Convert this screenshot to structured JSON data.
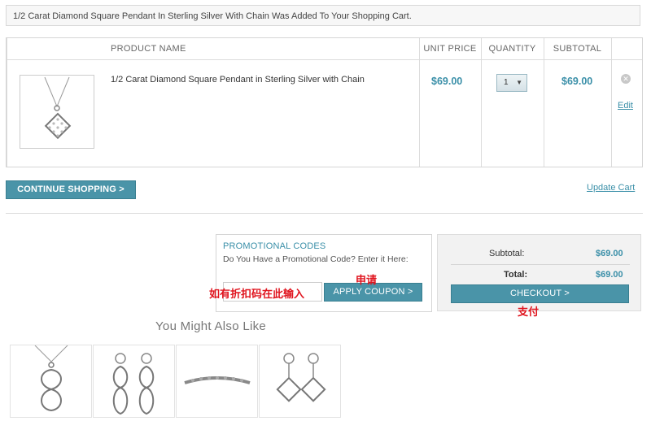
{
  "notice": {
    "message": "1/2 Carat Diamond Square Pendant In Sterling Silver With Chain Was Added To Your Shopping Cart."
  },
  "cart": {
    "headers": {
      "product_name": "PRODUCT NAME",
      "unit_price": "UNIT PRICE",
      "quantity": "QUANTITY",
      "subtotal": "SUBTOTAL"
    },
    "item": {
      "name": "1/2 Carat Diamond Square Pendant in Sterling Silver with Chain",
      "unit_price": "$69.00",
      "quantity": "1",
      "subtotal": "$69.00",
      "edit_label": "Edit"
    }
  },
  "actions": {
    "continue_label": "CONTINUE SHOPPING >",
    "update_label": "Update Cart"
  },
  "promo": {
    "title": "PROMOTIONAL CODES",
    "question": "Do You Have a Promotional Code? Enter it Here:",
    "input_value": "",
    "apply_label": "APPLY COUPON >"
  },
  "summary": {
    "subtotal_label": "Subtotal:",
    "subtotal_value": "$69.00",
    "total_label": "Total:",
    "total_value": "$69.00",
    "checkout_label": "CHECKOUT >"
  },
  "annotations": {
    "apply": "申请",
    "coupon_hint": "如有折扣码在此输入",
    "checkout": "支付"
  },
  "recommendations": {
    "title": "You Might Also Like"
  },
  "colors": {
    "accent": "#4a94a8",
    "link": "#3a8fa8",
    "annotation": "#e0141e"
  }
}
